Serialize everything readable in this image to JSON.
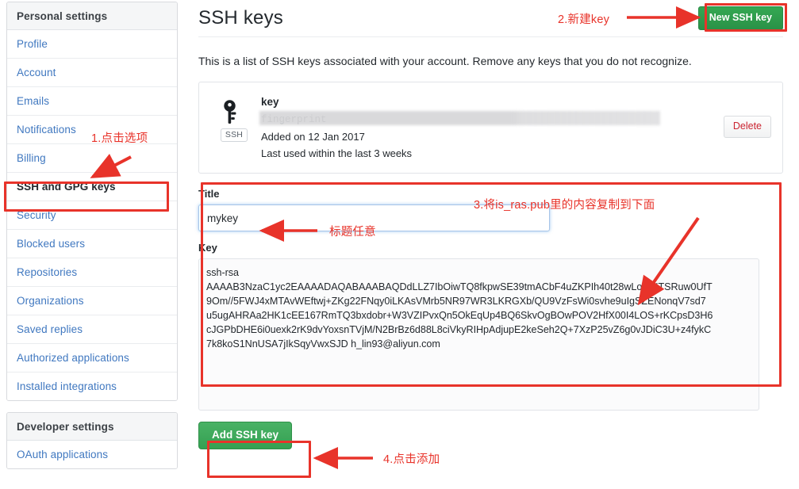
{
  "sidebar": {
    "personal": {
      "header": "Personal settings",
      "items": [
        {
          "label": "Profile",
          "selected": false
        },
        {
          "label": "Account",
          "selected": false
        },
        {
          "label": "Emails",
          "selected": false
        },
        {
          "label": "Notifications",
          "selected": false
        },
        {
          "label": "Billing",
          "selected": false
        },
        {
          "label": "SSH and GPG keys",
          "selected": true
        },
        {
          "label": "Security",
          "selected": false
        },
        {
          "label": "Blocked users",
          "selected": false
        },
        {
          "label": "Repositories",
          "selected": false
        },
        {
          "label": "Organizations",
          "selected": false
        },
        {
          "label": "Saved replies",
          "selected": false
        },
        {
          "label": "Authorized applications",
          "selected": false
        },
        {
          "label": "Installed integrations",
          "selected": false
        }
      ]
    },
    "developer": {
      "header": "Developer settings",
      "items": [
        {
          "label": "OAuth applications",
          "selected": false
        }
      ]
    }
  },
  "main": {
    "page_title": "SSH keys",
    "new_key_button": "New SSH key",
    "lead": "This is a list of SSH keys associated with your account. Remove any keys that you do not recognize.",
    "key_card": {
      "icon": "key-icon",
      "badge": "SSH",
      "title": "key",
      "fingerprint": "fingerprint",
      "fingerprint_redacted": true,
      "added": "Added on 12 Jan 2017",
      "last_used": "Last used within the last 3 weeks",
      "delete_button": "Delete"
    },
    "form": {
      "title_label": "Title",
      "title_value": "mykey",
      "title_placeholder": "",
      "key_label": "Key",
      "key_value": "ssh-rsa\nAAAAB3NzaC1yc2EAAAADAQABAAABAQDdLLZ7IbOiwTQ8fkpwSE39tmACbF4uZKPIh40t28wLotFNTSRuw0UfT\n9Om//5FWJ4xMTAvWEftwj+ZKg22FNqy0iLKAsVMrb5NR97WR3LKRGXb/QU9VzFsWi0svhe9uIgSZENonqV7sd7\nu5ugAHRAa2HK1cEE167RmTQ3bxdobr+W3VZIPvxQn5OkEqUp4BQ6SkvOgBOwPOV2HfX00I4LOS+rKCpsD3H6\ncJGPbDHE6i0uexk2rK9dvYoxsnTVjM/N2BrBz6d88L8ciVkyRIHpAdjupE2keSeh2Q+7XzP25vZ6g0vJDiC3U+z4fykC\n7k8koS1NnUSA7jIkSqyVwxSJD h_lin93@aliyun.com",
      "key_placeholder": "",
      "submit_button": "Add SSH key"
    }
  },
  "annotations": {
    "color": "#e8332a",
    "step1": "1.点击选项",
    "step2": "2.新建key",
    "step3": "3.将is_ras.pub里的内容复制到下面",
    "step4": "4.点击添加",
    "note_title": "标题任意"
  }
}
